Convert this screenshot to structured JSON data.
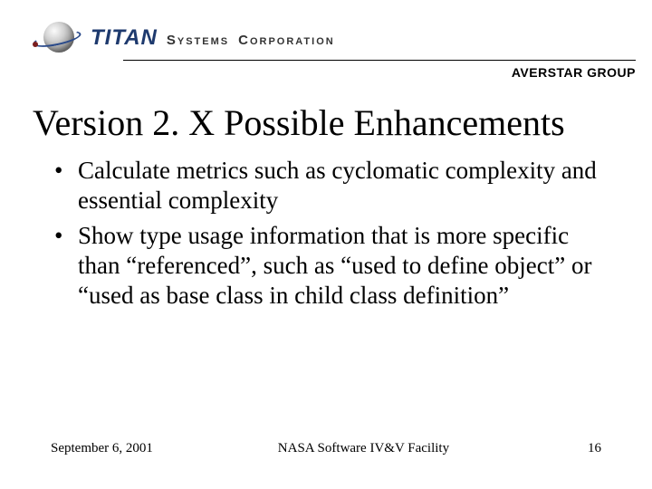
{
  "header": {
    "brand_titan": "TITAN",
    "brand_systems": "Systems",
    "brand_corporation": "Corporation",
    "subgroup": "AVERSTAR GROUP"
  },
  "title": "Version 2. X Possible Enhancements",
  "bullets": [
    "Calculate metrics such as cyclomatic complexity and essential complexity",
    "Show type usage information that is more specific than “referenced”, such as “used to define object” or “used as base class in child class definition”"
  ],
  "footer": {
    "date": "September 6, 2001",
    "center": "NASA Software IV&V Facility",
    "page": "16"
  }
}
